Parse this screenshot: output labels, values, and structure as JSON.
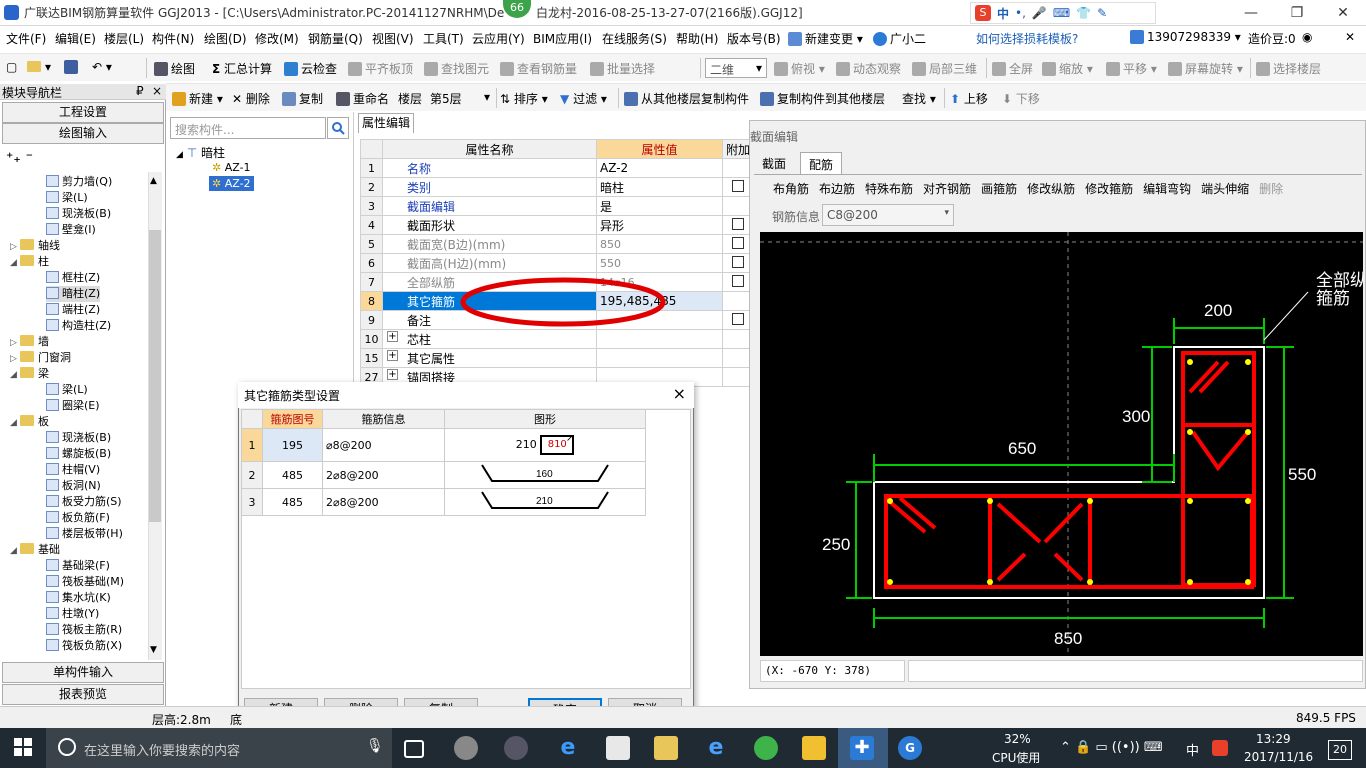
{
  "title_bar": {
    "app_title": "广联达BIM钢筋算量软件 GGJ2013 - [C:\\Users\\Administrator.PC-20141127NRHM\\De",
    "title_tail": "白龙村-2016-08-25-13-27-07(2166版).GGJ12]",
    "badge": "66",
    "ime_label": "中"
  },
  "menu": [
    "文件(F)",
    "编辑(E)",
    "楼层(L)",
    "构件(N)",
    "绘图(D)",
    "修改(M)",
    "钢筋量(Q)",
    "视图(V)",
    "工具(T)",
    "云应用(Y)",
    "BIM应用(I)",
    "在线服务(S)",
    "帮助(H)",
    "版本号(B)",
    "新建变更",
    "广小二"
  ],
  "menu_right": {
    "help_link": "如何选择损耗模板?",
    "phone": "13907298339",
    "price": "造价豆:0"
  },
  "toolbar1": [
    "绘图",
    "汇总计算",
    "云检查",
    "平齐板顶",
    "查找图元",
    "查看钢筋量",
    "批量选择",
    "二维",
    "俯视",
    "动态观察",
    "局部三维",
    "全屏",
    "缩放",
    "平移",
    "屏幕旋转",
    "选择楼层"
  ],
  "toolbar2": {
    "new": "新建",
    "delete": "删除",
    "copy": "复制",
    "rename": "重命名",
    "floor_label": "楼层",
    "floor_value": "第5层",
    "sort": "排序",
    "filter": "过滤",
    "copy_from": "从其他楼层复制构件",
    "copy_to": "复制构件到其他楼层",
    "find": "查找",
    "up": "上移",
    "down": "下移"
  },
  "nav": {
    "header": "模块导航栏",
    "pin": "₽",
    "close": "×",
    "btn_project": "工程设置",
    "btn_draw": "绘图输入",
    "btn_single": "单构件输入",
    "btn_report": "报表预览",
    "tree": [
      {
        "label": "剪力墙(Q)",
        "level": 2
      },
      {
        "label": "梁(L)",
        "level": 2
      },
      {
        "label": "现浇板(B)",
        "level": 2
      },
      {
        "label": "壁龛(I)",
        "level": 2
      },
      {
        "label": "轴线",
        "level": 0,
        "expand": "▷"
      },
      {
        "label": "柱",
        "level": 0,
        "expand": "◢"
      },
      {
        "label": "框柱(Z)",
        "level": 2
      },
      {
        "label": "暗柱(Z)",
        "level": 2,
        "selected": true
      },
      {
        "label": "端柱(Z)",
        "level": 2
      },
      {
        "label": "构造柱(Z)",
        "level": 2
      },
      {
        "label": "墙",
        "level": 0,
        "expand": "▷"
      },
      {
        "label": "门窗洞",
        "level": 0,
        "expand": "▷"
      },
      {
        "label": "梁",
        "level": 0,
        "expand": "◢"
      },
      {
        "label": "梁(L)",
        "level": 2
      },
      {
        "label": "圈梁(E)",
        "level": 2
      },
      {
        "label": "板",
        "level": 0,
        "expand": "◢"
      },
      {
        "label": "现浇板(B)",
        "level": 2
      },
      {
        "label": "螺旋板(B)",
        "level": 2
      },
      {
        "label": "柱帽(V)",
        "level": 2
      },
      {
        "label": "板洞(N)",
        "level": 2
      },
      {
        "label": "板受力筋(S)",
        "level": 2
      },
      {
        "label": "板负筋(F)",
        "level": 2
      },
      {
        "label": "楼层板带(H)",
        "level": 2
      },
      {
        "label": "基础",
        "level": 0,
        "expand": "◢"
      },
      {
        "label": "基础梁(F)",
        "level": 2
      },
      {
        "label": "筏板基础(M)",
        "level": 2
      },
      {
        "label": "集水坑(K)",
        "level": 2
      },
      {
        "label": "柱墩(Y)",
        "level": 2
      },
      {
        "label": "筏板主筋(R)",
        "level": 2
      },
      {
        "label": "筏板负筋(X)",
        "level": 2
      }
    ]
  },
  "comp_list": {
    "search_placeholder": "搜索构件...",
    "root": "暗柱",
    "items": [
      "AZ-1",
      "AZ-2"
    ],
    "selected": "AZ-2"
  },
  "prop_editor": {
    "tab": "属性编辑",
    "col_name": "属性名称",
    "col_value": "属性值",
    "col_extra": "附加",
    "rows": [
      {
        "num": "1",
        "name": "名称",
        "value": "AZ-2",
        "checkbox": false,
        "blue": true
      },
      {
        "num": "2",
        "name": "类别",
        "value": "暗柱",
        "checkbox": true,
        "blue": true
      },
      {
        "num": "3",
        "name": "截面编辑",
        "value": "是",
        "checkbox": false,
        "blue": true
      },
      {
        "num": "4",
        "name": "截面形状",
        "value": "异形",
        "checkbox": true,
        "blue": false
      },
      {
        "num": "5",
        "name": "截面宽(B边)(mm)",
        "value": "850",
        "checkbox": true,
        "gray": true
      },
      {
        "num": "6",
        "name": "截面高(H边)(mm)",
        "value": "550",
        "checkbox": true,
        "gray": true
      },
      {
        "num": "7",
        "name": "全部纵筋",
        "value": "14⌀16",
        "checkbox": true,
        "gray": true
      },
      {
        "num": "8",
        "name": "其它箍筋",
        "value": "195,485,485",
        "checkbox": false,
        "selected": true
      },
      {
        "num": "9",
        "name": "备注",
        "value": "",
        "checkbox": true
      },
      {
        "num": "10",
        "name": "芯柱",
        "value": "",
        "checkbox": false,
        "plus": true
      },
      {
        "num": "15",
        "name": "其它属性",
        "value": "",
        "checkbox": false,
        "plus": true
      },
      {
        "num": "27",
        "name": "锚固搭接",
        "value": "",
        "checkbox": false,
        "plus": true
      }
    ]
  },
  "section_editor": {
    "title": "截面编辑",
    "tabs": [
      "截面",
      "配筋"
    ],
    "active_tab": "配筋",
    "tools": [
      "布角筋",
      "布边筋",
      "特殊布筋",
      "对齐钢筋",
      "画箍筋",
      "修改纵筋",
      "修改箍筋",
      "编辑弯钩",
      "端头伸缩",
      "删除"
    ],
    "rebar_label": "钢筋信息",
    "rebar_value": "C8@200",
    "dims": {
      "d200": "200",
      "d300": "300",
      "d650": "650",
      "d550": "550",
      "d250": "250",
      "d850": "850"
    },
    "callout_line1": "全部纵",
    "callout_line2": "箍筋",
    "coord": "(X: -670 Y: 378)"
  },
  "dialog": {
    "title": "其它箍筋类型设置",
    "close": "×",
    "col_num": "",
    "col_code": "箍筋图号",
    "col_info": "箍筋信息",
    "col_shape": "图形",
    "rows": [
      {
        "num": "1",
        "code": "195",
        "info": "⌀8@200",
        "shape_a": "210",
        "shape_b": "810"
      },
      {
        "num": "2",
        "code": "485",
        "info": "2⌀8@200",
        "shape_a": "160"
      },
      {
        "num": "3",
        "code": "485",
        "info": "2⌀8@200",
        "shape_a": "210"
      }
    ],
    "buttons": {
      "new": "新建",
      "delete": "删除",
      "copy": "复制",
      "ok": "确定",
      "cancel": "取消"
    }
  },
  "status": {
    "floor_height": "层高:2.8m",
    "fps": "849.5 FPS",
    "cut": "底"
  },
  "taskbar": {
    "search": "在这里输入你要搜索的内容",
    "cpu_pct": "32%",
    "cpu_label": "CPU使用",
    "time": "13:29",
    "date": "2017/11/16",
    "ime": "中",
    "notif": "20"
  },
  "colors": {
    "accent": "#0078d7",
    "rebar": "#ff0000",
    "dim": "#00cc00",
    "canvas": "#000000"
  }
}
